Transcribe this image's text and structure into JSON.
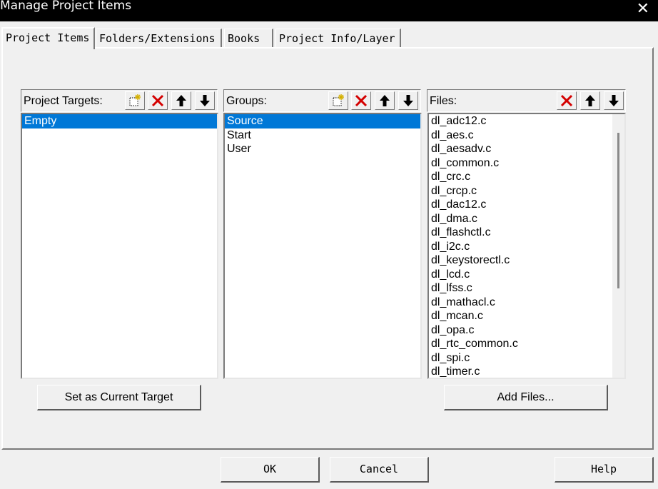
{
  "window": {
    "title": "Manage Project Items",
    "close_glyph": "✕"
  },
  "tabs": [
    {
      "label": "Project Items",
      "active": true
    },
    {
      "label": "Folders/Extensions",
      "active": false
    },
    {
      "label": "Books",
      "active": false
    },
    {
      "label": "Project Info/Layer",
      "active": false
    }
  ],
  "targets": {
    "label": "Project Targets:",
    "items": [
      "Empty"
    ]
  },
  "groups": {
    "label": "Groups:",
    "items": [
      "Source",
      "Start",
      "User"
    ]
  },
  "files": {
    "label": "Files:",
    "items": [
      "dl_adc12.c",
      "dl_aes.c",
      "dl_aesadv.c",
      "dl_common.c",
      "dl_crc.c",
      "dl_crcp.c",
      "dl_dac12.c",
      "dl_dma.c",
      "dl_flashctl.c",
      "dl_i2c.c",
      "dl_keystorectl.c",
      "dl_lcd.c",
      "dl_lfss.c",
      "dl_mathacl.c",
      "dl_mcan.c",
      "dl_opa.c",
      "dl_rtc_common.c",
      "dl_spi.c",
      "dl_timer.c"
    ]
  },
  "buttons": {
    "set_target": "Set as Current Target",
    "add_files": "Add Files...",
    "ok": "OK",
    "cancel": "Cancel",
    "help": "Help"
  },
  "colors": {
    "selection": "#0078d7",
    "delete_red": "#d40000",
    "titlebar": "#000000"
  }
}
